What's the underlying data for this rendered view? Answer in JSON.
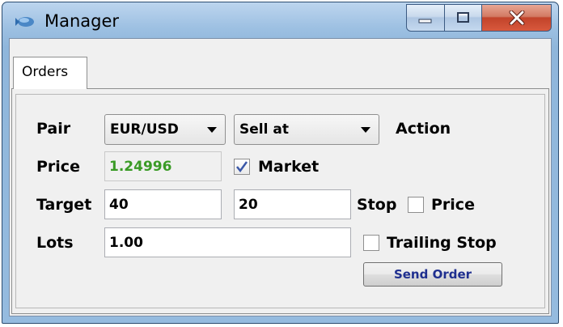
{
  "window": {
    "title": "Manager"
  },
  "tabs": [
    {
      "label": "Orders",
      "selected": true
    }
  ],
  "form": {
    "pair": {
      "label": "Pair",
      "value": "EUR/USD"
    },
    "action": {
      "value": "Sell at",
      "label": "Action"
    },
    "price": {
      "label": "Price",
      "value": "1.24996",
      "market_label": "Market",
      "market_checked": true
    },
    "target": {
      "label": "Target",
      "value": "40"
    },
    "stop": {
      "value": "20",
      "label": "Stop",
      "price_label": "Price",
      "price_checked": false
    },
    "lots": {
      "label": "Lots",
      "value": "1.00",
      "trailing_label": "Trailing Stop",
      "trailing_checked": false
    },
    "send_button": "Send Order"
  },
  "colors": {
    "price_value": "#3a9b26",
    "send_button_text": "#1f2f8f",
    "close_button": "#c2432a",
    "checkmark": "#3a57a8"
  },
  "icons": {
    "app": "manager-app-icon",
    "minimize": "minimize-icon",
    "maximize": "maximize-icon",
    "close": "close-icon"
  }
}
